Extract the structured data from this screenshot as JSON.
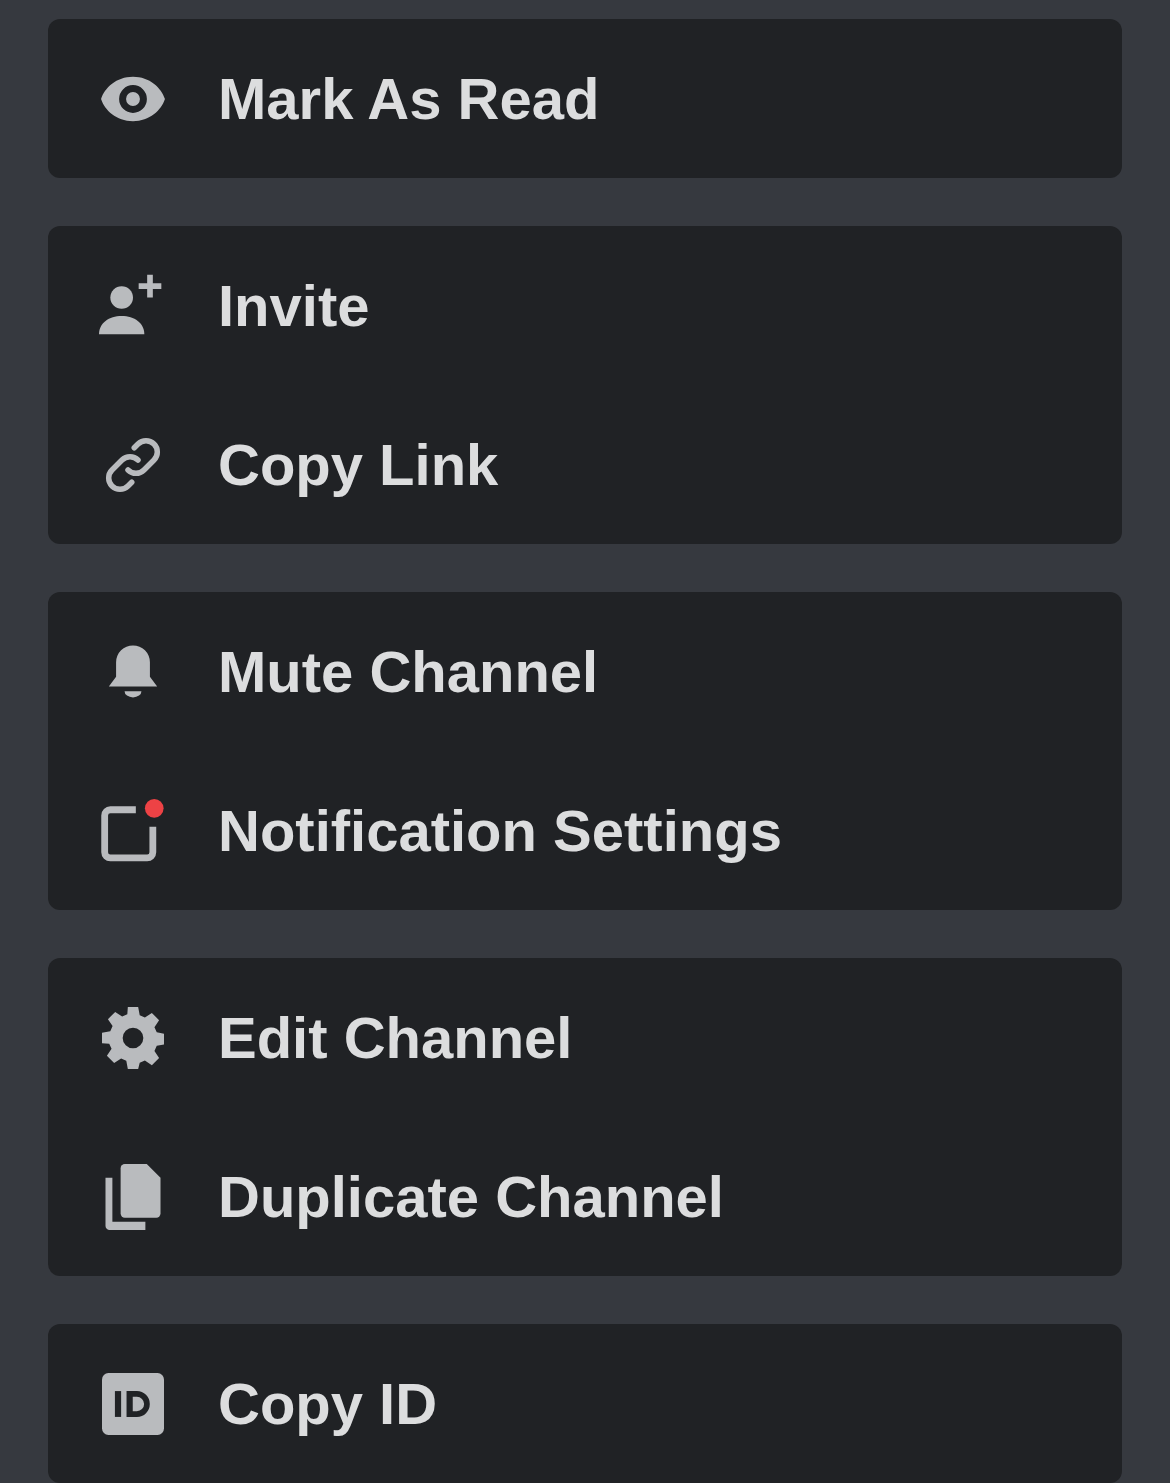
{
  "menu_groups": [
    {
      "items": [
        {
          "label": "Mark As Read"
        }
      ]
    },
    {
      "items": [
        {
          "label": "Invite"
        },
        {
          "label": "Copy Link"
        }
      ]
    },
    {
      "items": [
        {
          "label": "Mute Channel"
        },
        {
          "label": "Notification Settings"
        }
      ]
    },
    {
      "items": [
        {
          "label": "Edit Channel"
        },
        {
          "label": "Duplicate Channel"
        }
      ]
    },
    {
      "items": [
        {
          "label": "Copy ID"
        }
      ]
    }
  ]
}
